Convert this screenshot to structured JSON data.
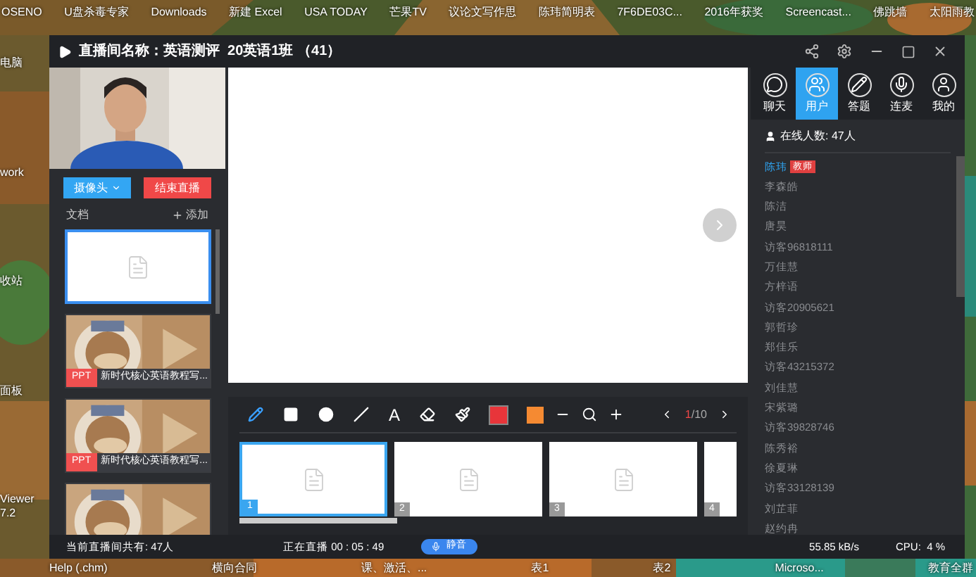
{
  "desktop": {
    "top_row": [
      "OSENO",
      "U盘杀毒专家",
      "Downloads",
      "新建 Excel",
      "USA TODAY",
      "芒果TV",
      "议论文写作思",
      "陈玮简明表",
      "7F6DE03C...",
      "2016年获奖",
      "Screencast...",
      "佛跳墙",
      "太阳雨教"
    ],
    "left_column": [
      "电脑",
      "work",
      "收站",
      "面板",
      "Viewer 7.2"
    ],
    "bottom_row": [
      "Help (.chm)",
      "横向合同",
      "课、激活、...",
      "表1",
      "表2",
      "Microso...",
      "教育全群"
    ]
  },
  "window": {
    "title": "直播间名称：英语测评  20英语1班 （41）"
  },
  "camera_button": "摄像头",
  "end_button": "结束直播",
  "documents": {
    "title": "文档",
    "add": "添加",
    "items": [
      {
        "kind": "blank",
        "selected": true
      },
      {
        "kind": "ppt",
        "badge": "PPT",
        "name": "新时代核心英语教程写...",
        "selected": false
      },
      {
        "kind": "ppt",
        "badge": "PPT",
        "name": "新时代核心英语教程写...",
        "selected": false
      },
      {
        "kind": "ppt",
        "selected": false
      }
    ]
  },
  "tools": [
    {
      "kind": "pen",
      "selected": true
    },
    {
      "kind": "rect",
      "selected": false
    },
    {
      "kind": "circle",
      "selected": false
    },
    {
      "kind": "line",
      "selected": false
    },
    {
      "kind": "text",
      "label": "A",
      "selected": false
    },
    {
      "kind": "eraser",
      "selected": false
    },
    {
      "kind": "clear",
      "selected": false
    }
  ],
  "colors": [
    {
      "color": "#e8353a",
      "selected": true
    },
    {
      "color": "#f58a32",
      "selected": false
    }
  ],
  "page": {
    "current": "1",
    "total": "/10"
  },
  "slides": [
    {
      "kind": "full",
      "number": "1",
      "selected": true
    },
    {
      "kind": "full",
      "number": "2",
      "selected": false
    },
    {
      "kind": "full",
      "number": "3",
      "selected": false
    },
    {
      "kind": "cut",
      "number": "4",
      "selected": false
    }
  ],
  "tabs": [
    {
      "kind": "chat",
      "label": "聊天",
      "selected": false
    },
    {
      "kind": "users",
      "label": "用户",
      "selected": true
    },
    {
      "kind": "answer",
      "label": "答题",
      "selected": false
    },
    {
      "kind": "mic",
      "label": "连麦",
      "selected": false
    },
    {
      "kind": "me",
      "label": "我的",
      "selected": false
    }
  ],
  "online": "在线人数: 47人",
  "users": [
    {
      "name": "陈玮",
      "badge": "教师",
      "selected": true
    },
    {
      "name": "李森皓",
      "selected": false
    },
    {
      "name": "陈洁",
      "selected": false
    },
    {
      "name": "唐昊",
      "selected": false
    },
    {
      "name": "访客96818111",
      "selected": false
    },
    {
      "name": "万佳慧",
      "selected": false
    },
    {
      "name": "方梓语",
      "selected": false
    },
    {
      "name": "访客20905621",
      "selected": false
    },
    {
      "name": "郭哲珍",
      "selected": false
    },
    {
      "name": "郑佳乐",
      "selected": false
    },
    {
      "name": "访客43215372",
      "selected": false
    },
    {
      "name": "刘佳慧",
      "selected": false
    },
    {
      "name": "宋紫璐",
      "selected": false
    },
    {
      "name": "访客39828746",
      "selected": false
    },
    {
      "name": "陈秀裕",
      "selected": false
    },
    {
      "name": "徐夏琳",
      "selected": false
    },
    {
      "name": "访客33128139",
      "selected": false
    },
    {
      "name": "刘芷菲",
      "selected": false
    },
    {
      "name": "赵约冉",
      "selected": false
    }
  ],
  "status": {
    "audience": "当前直播间共有: 47人",
    "live": "正在直播 00 : 05 : 49",
    "mute": "静音",
    "speed": "55.85 kB/s",
    "cpu": "CPU:  4 %"
  }
}
